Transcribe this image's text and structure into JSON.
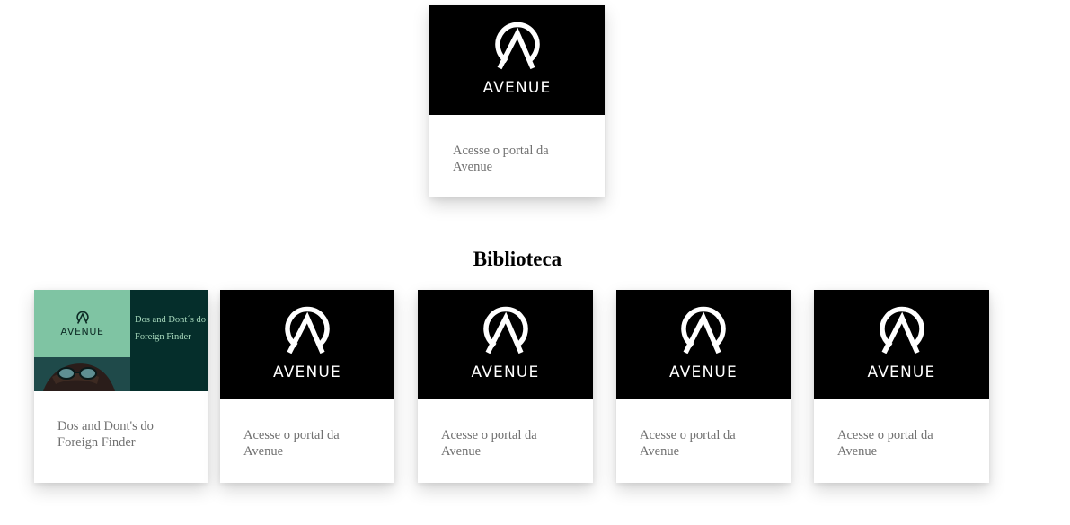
{
  "featured_card": {
    "brand": "AVENUE",
    "caption": "Acesse o portal da Avenue"
  },
  "section": {
    "title": "Biblioteca"
  },
  "library_cards": [
    {
      "image_heading": "Dos and Dont´s do Foreign Finder",
      "image_brand": "AVENUE",
      "caption": "Dos and Dont's do Foreign Finder"
    },
    {
      "brand": "AVENUE",
      "caption": "Acesse o portal da Avenue"
    },
    {
      "brand": "AVENUE",
      "caption": "Acesse o portal da Avenue"
    },
    {
      "brand": "AVENUE",
      "caption": "Acesse o portal da Avenue"
    },
    {
      "brand": "AVENUE",
      "caption": "Acesse o portal da Avenue"
    }
  ],
  "colors": {
    "card_media_bg": "#000000",
    "caption_text": "#707070",
    "ff_mint": "#7fc4a3",
    "ff_dark_green": "#052e2b"
  },
  "icons": {
    "logo": "avenue-logo-icon"
  }
}
